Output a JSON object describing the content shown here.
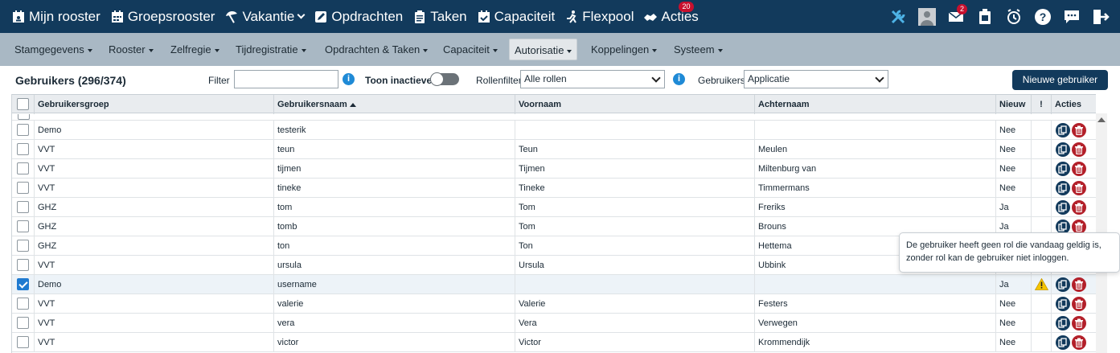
{
  "topnav": {
    "items": [
      {
        "label": "Mijn rooster",
        "icon": "calendar-user-icon"
      },
      {
        "label": "Groepsrooster",
        "icon": "calendar-grid-icon"
      },
      {
        "label": "Vakantie",
        "icon": "beach-umbrella-icon"
      },
      {
        "label": "Opdrachten",
        "icon": "edit-icon"
      },
      {
        "label": "Taken",
        "icon": "clipboard-list-icon"
      },
      {
        "label": "Capaciteit",
        "icon": "calendar-check-icon"
      },
      {
        "label": "Flexpool",
        "icon": "running-person-icon"
      },
      {
        "label": "Acties",
        "icon": "handshake-icon",
        "badge": "20"
      }
    ],
    "right_icons": [
      "tools-icon",
      "user-avatar-icon",
      "mail-icon",
      "clipboard-icon",
      "alarm-icon",
      "help-icon",
      "chat-icon",
      "logout-icon"
    ],
    "mail_badge": "2"
  },
  "menubar": {
    "items": [
      {
        "label": "Stamgegevens"
      },
      {
        "label": "Rooster"
      },
      {
        "label": "Zelfregie"
      },
      {
        "label": "Tijdregistratie"
      },
      {
        "label": "Opdrachten & Taken"
      },
      {
        "label": "Capaciteit"
      },
      {
        "label": "Autorisatie",
        "active": true
      },
      {
        "label": "Koppelingen"
      },
      {
        "label": "Systeem"
      }
    ]
  },
  "toolbar": {
    "title": "Gebruikers (296/374)",
    "filter_label": "Filter",
    "filter_value": "",
    "toon_inactieve_label": "Toon inactieve",
    "rollenfilter_label": "Rollenfilter",
    "rollenfilter_value": "Alle rollen",
    "gebruikers_label": "Gebruikers",
    "gebruikers_value": "Applicatie",
    "new_button": "Nieuwe gebruiker",
    "info_glyph": "i"
  },
  "table": {
    "headers": {
      "group": "Gebruikersgroep",
      "username": "Gebruikersnaam",
      "firstname": "Voornaam",
      "lastname": "Achternaam",
      "new": "Nieuw",
      "warn": "!",
      "actions": "Acties"
    },
    "rows": [
      {
        "group": "Demo",
        "username": "testerik",
        "firstname": "",
        "lastname": "",
        "new": "Nee",
        "selected": false,
        "warning": false
      },
      {
        "group": "VVT",
        "username": "teun",
        "firstname": "Teun",
        "lastname": "Meulen",
        "new": "Nee",
        "selected": false,
        "warning": false
      },
      {
        "group": "VVT",
        "username": "tijmen",
        "firstname": "Tijmen",
        "lastname": "Miltenburg van",
        "new": "Nee",
        "selected": false,
        "warning": false
      },
      {
        "group": "VVT",
        "username": "tineke",
        "firstname": "Tineke",
        "lastname": "Timmermans",
        "new": "Nee",
        "selected": false,
        "warning": false
      },
      {
        "group": "GHZ",
        "username": "tom",
        "firstname": "Tom",
        "lastname": "Freriks",
        "new": "Ja",
        "selected": false,
        "warning": false
      },
      {
        "group": "GHZ",
        "username": "tomb",
        "firstname": "Tom",
        "lastname": "Brouns",
        "new": "Ja",
        "selected": false,
        "warning": false
      },
      {
        "group": "GHZ",
        "username": "ton",
        "firstname": "Ton",
        "lastname": "Hettema",
        "new": "",
        "selected": false,
        "warning": false
      },
      {
        "group": "VVT",
        "username": "ursula",
        "firstname": "Ursula",
        "lastname": "Ubbink",
        "new": "",
        "selected": false,
        "warning": false
      },
      {
        "group": "Demo",
        "username": "username",
        "firstname": "",
        "lastname": "",
        "new": "Ja",
        "selected": true,
        "warning": true
      },
      {
        "group": "VVT",
        "username": "valerie",
        "firstname": "Valerie",
        "lastname": "Festers",
        "new": "Nee",
        "selected": false,
        "warning": false
      },
      {
        "group": "VVT",
        "username": "vera",
        "firstname": "Vera",
        "lastname": "Verwegen",
        "new": "Nee",
        "selected": false,
        "warning": false
      },
      {
        "group": "VVT",
        "username": "victor",
        "firstname": "Victor",
        "lastname": "Krommendijk",
        "new": "Nee",
        "selected": false,
        "warning": false
      }
    ]
  },
  "tooltip": {
    "text": "De gebruiker heeft geen rol die vandaag geldig is, zonder rol kan de gebruiker niet inloggen."
  },
  "colors": {
    "topbar": "#123a5c",
    "menubar": "#a9b8c4",
    "accent_blue": "#1f8ad6",
    "delete_red": "#b3202a",
    "warning_yellow": "#f5c400"
  }
}
